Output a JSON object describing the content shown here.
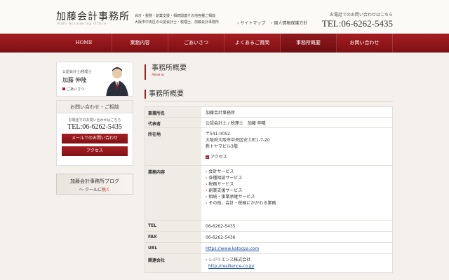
{
  "header": {
    "logo": "加藤会計事務所",
    "logo_sub": "Kato Accounting Office",
    "tagline_1": "会計・税務・創業支援・相続関連その他各種ご相談",
    "tagline_2": "大阪市中央区の公認会計士・税理士、加藤会計事務所",
    "sitemap": "サイトマップ",
    "privacy": "個人情報保護方針",
    "tel_label": "お電話でのお問い合わせはこちら",
    "tel_number": "TEL:06-6262-5435"
  },
  "nav": [
    "HOME",
    "業務内容",
    "ごあいさつ",
    "よくあるご質問",
    "事務所概要",
    "お問い合わせ"
  ],
  "sidebar": {
    "profile_role": "公認会計士/税理士",
    "profile_name": "加藤 伸隆",
    "profile_greeting": "ごあいさつ",
    "contact_title": "お問い合わせ・ご相談",
    "contact_label": "お電話でのお問い合わせはこちら",
    "contact_tel": "TEL:06-6262-5435",
    "mail_button": "メールでのお問い合わせ",
    "access_button": "アクセス",
    "blog_title": "加藤会計事務所ブログ",
    "blog_sub_prefix": "～ クールに",
    "blog_sub_hot": "熱く"
  },
  "main": {
    "page_title": "事務所概要",
    "page_subtitle": "About us",
    "section_title": "事務所概要",
    "table": {
      "office_name_label": "事業所名",
      "office_name": "加藤会計事務所",
      "rep_label": "代表者",
      "rep": "公認会計士 / 税理士　加藤 伸隆",
      "address_label": "所在地",
      "address_1": "〒541-0052",
      "address_2": "大阪府大阪市中央区安土町1-7-20",
      "address_3": "新トヤマビル3階",
      "access": "アクセス",
      "biz_label": "業務内容",
      "services": [
        "会計サービス",
        "各種相談サービス",
        "税務サービス",
        "創業支援サービス",
        "相続・事業承継サービス",
        "その他、会計・税務にかかわる業務"
      ],
      "tel_label": "TEL",
      "tel": "06-6262-5435",
      "fax_label": "FAX",
      "fax": "06-6262-5436",
      "url_label": "URL",
      "url": "https://www.katocpa.com",
      "related_label": "関連会社",
      "related_name": "レジリエンス株式会社",
      "related_url": "http://resilience-co.jp/"
    }
  }
}
